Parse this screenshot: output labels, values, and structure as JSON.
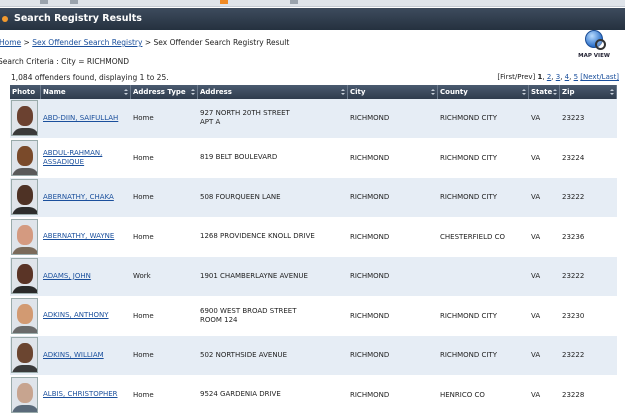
{
  "page": {
    "title": "Search Registry Results",
    "breadcrumb": {
      "home": "Home",
      "sep1": ">",
      "search": "Sex Offender Search Registry",
      "sep2": ">",
      "current": "Sex Offender Search Registry Result"
    },
    "criteria": "Search Criteria : City = RICHMOND",
    "map_view_label": "MAP VIEW",
    "results_count": "1,084 offenders found, displaying 1 to 25.",
    "pager": {
      "first_prev": "[First/Prev]",
      "current_page": "1",
      "pages": [
        "2",
        "3",
        "4",
        "5"
      ],
      "next_last": "[Next/Last]"
    }
  },
  "table": {
    "headers": [
      "Photo",
      "Name",
      "Address Type",
      "Address",
      "City",
      "County",
      "State",
      "Zip"
    ],
    "rows": [
      {
        "name": "ABD-DIIN, SAIFULLAH",
        "address_type": "Home",
        "address_line1": "927 NORTH 20TH STREET",
        "address_line2": "APT A",
        "city": "RICHMOND",
        "county": "RICHMOND CITY",
        "state": "VA",
        "zip": "23223",
        "skin": "#6b4130",
        "shirt": "#3a3a3a"
      },
      {
        "name": "ABDUL-RAHMAN, ASSADIQUE",
        "address_type": "Home",
        "address_line1": "819 BELT BOULEVARD",
        "address_line2": "",
        "city": "RICHMOND",
        "county": "RICHMOND CITY",
        "state": "VA",
        "zip": "23224",
        "skin": "#7a4a2a",
        "shirt": "#5a5a5a"
      },
      {
        "name": "ABERNATHY, CHAKA",
        "address_type": "Home",
        "address_line1": "508 FOURQUEEN LANE",
        "address_line2": "",
        "city": "RICHMOND",
        "county": "RICHMOND CITY",
        "state": "VA",
        "zip": "23222",
        "skin": "#4e3225",
        "shirt": "#2d2d2d"
      },
      {
        "name": "ABERNATHY, WAYNE",
        "address_type": "Home",
        "address_line1": "1268 PROVIDENCE KNOLL DRIVE",
        "address_line2": "",
        "city": "RICHMOND",
        "county": "CHESTERFIELD CO",
        "state": "VA",
        "zip": "23236",
        "skin": "#d49a80",
        "shirt": "#7a6a5a"
      },
      {
        "name": "ADAMS, JOHN",
        "address_type": "Work",
        "address_line1": "1901 CHAMBERLAYNE AVENUE",
        "address_line2": "",
        "city": "RICHMOND",
        "county": "",
        "state": "VA",
        "zip": "23222",
        "skin": "#5a3426",
        "shirt": "#2a2a2a"
      },
      {
        "name": "ADKINS, ANTHONY",
        "address_type": "Home",
        "address_line1": "6900 WEST BROAD STREET",
        "address_line2": "ROOM 124",
        "city": "RICHMOND",
        "county": "RICHMOND CITY",
        "state": "VA",
        "zip": "23230",
        "skin": "#d29a72",
        "shirt": "#6a6a6a"
      },
      {
        "name": "ADKINS, WILLIAM",
        "address_type": "Home",
        "address_line1": "502 NORTHSIDE AVENUE",
        "address_line2": "",
        "city": "RICHMOND",
        "county": "RICHMOND CITY",
        "state": "VA",
        "zip": "23222",
        "skin": "#6b4530",
        "shirt": "#3a3a3a"
      },
      {
        "name": "ALBIS, CHRISTOPHER",
        "address_type": "Home",
        "address_line1": "9524 GARDENIA DRIVE",
        "address_line2": "",
        "city": "RICHMOND",
        "county": "HENRICO CO",
        "state": "VA",
        "zip": "23228",
        "skin": "#c7a48f",
        "shirt": "#5a6a7a"
      }
    ]
  },
  "colors": {
    "titlebar": "#2f3c4d",
    "row_alt": "#e6edf5",
    "link": "#1a4f9c",
    "accent": "#f39a2e"
  },
  "icons": {
    "title": "orange-dot-icon",
    "map_view": "globe-magnifier-icon",
    "sort": "sort-arrows-icon",
    "photo": "mugshot-photo"
  }
}
